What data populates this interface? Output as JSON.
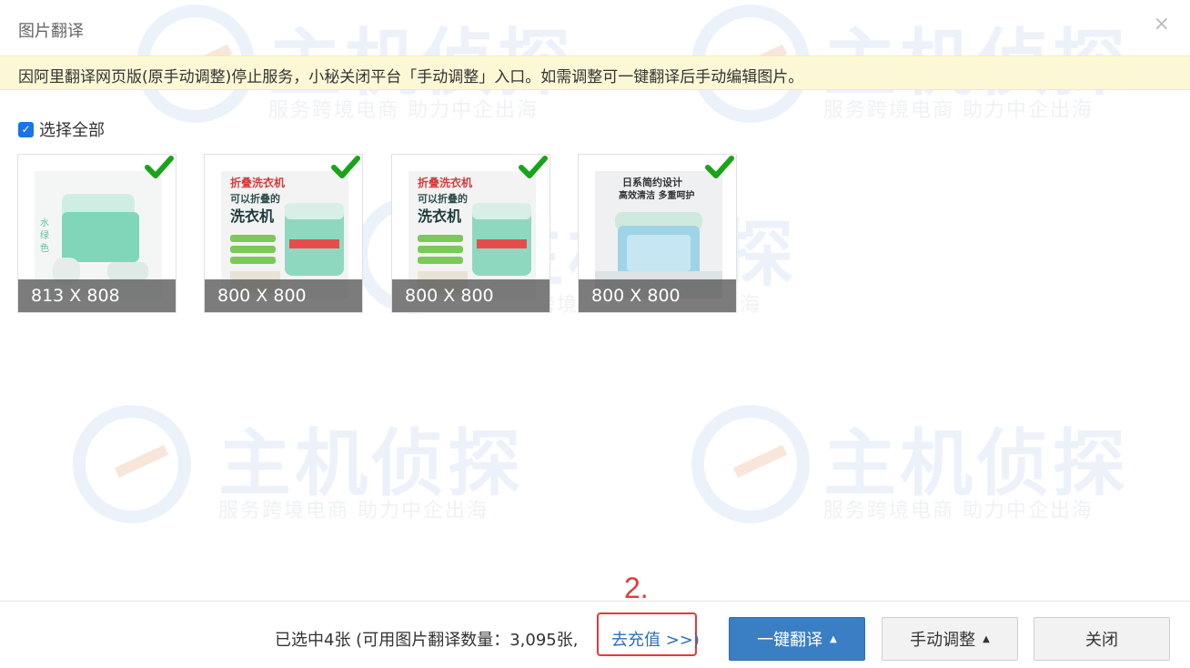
{
  "dialog": {
    "title": "图片翻译",
    "close_glyph": "×"
  },
  "notice": {
    "text": "因阿里翻译网页版(原手动调整)停止服务，小秘关闭平台「手动调整」入口。如需调整可一键翻译后手动编辑图片。"
  },
  "select_all": {
    "label": "选择全部",
    "checked": true
  },
  "images": [
    {
      "dimensions": "813 X 808",
      "selected": true,
      "accent": "#7fd6b8"
    },
    {
      "dimensions": "800 X 800",
      "selected": true,
      "accent": "#8fd8c0",
      "caption": "折叠洗衣机",
      "subcaption": "可以折叠的",
      "headline": "洗衣机"
    },
    {
      "dimensions": "800 X 800",
      "selected": true,
      "accent": "#8fd8c0",
      "caption": "折叠洗衣机",
      "subcaption": "可以折叠的",
      "headline": "洗衣机"
    },
    {
      "dimensions": "800 X 800",
      "selected": true,
      "accent": "#9fd4e8",
      "caption": "日系简约设计",
      "subcaption": "高效清洁 多重呵护"
    }
  ],
  "footer": {
    "selected_info": "已选中4张 (可用图片翻译数量：3,095张,",
    "recharge_label": "去充值 >>)",
    "step_label": "2.",
    "one_click_label": "一键翻译",
    "manual_label": "手动调整",
    "close_label": "关闭"
  },
  "watermark": {
    "brand": "主机侦探",
    "slogan": "服务跨境电商 助力中企出海"
  },
  "colors": {
    "primary": "#3a7fc4",
    "check_green": "#1aa31a",
    "highlight_red": "#e23b3b",
    "notice_bg": "#fcf8d6"
  }
}
